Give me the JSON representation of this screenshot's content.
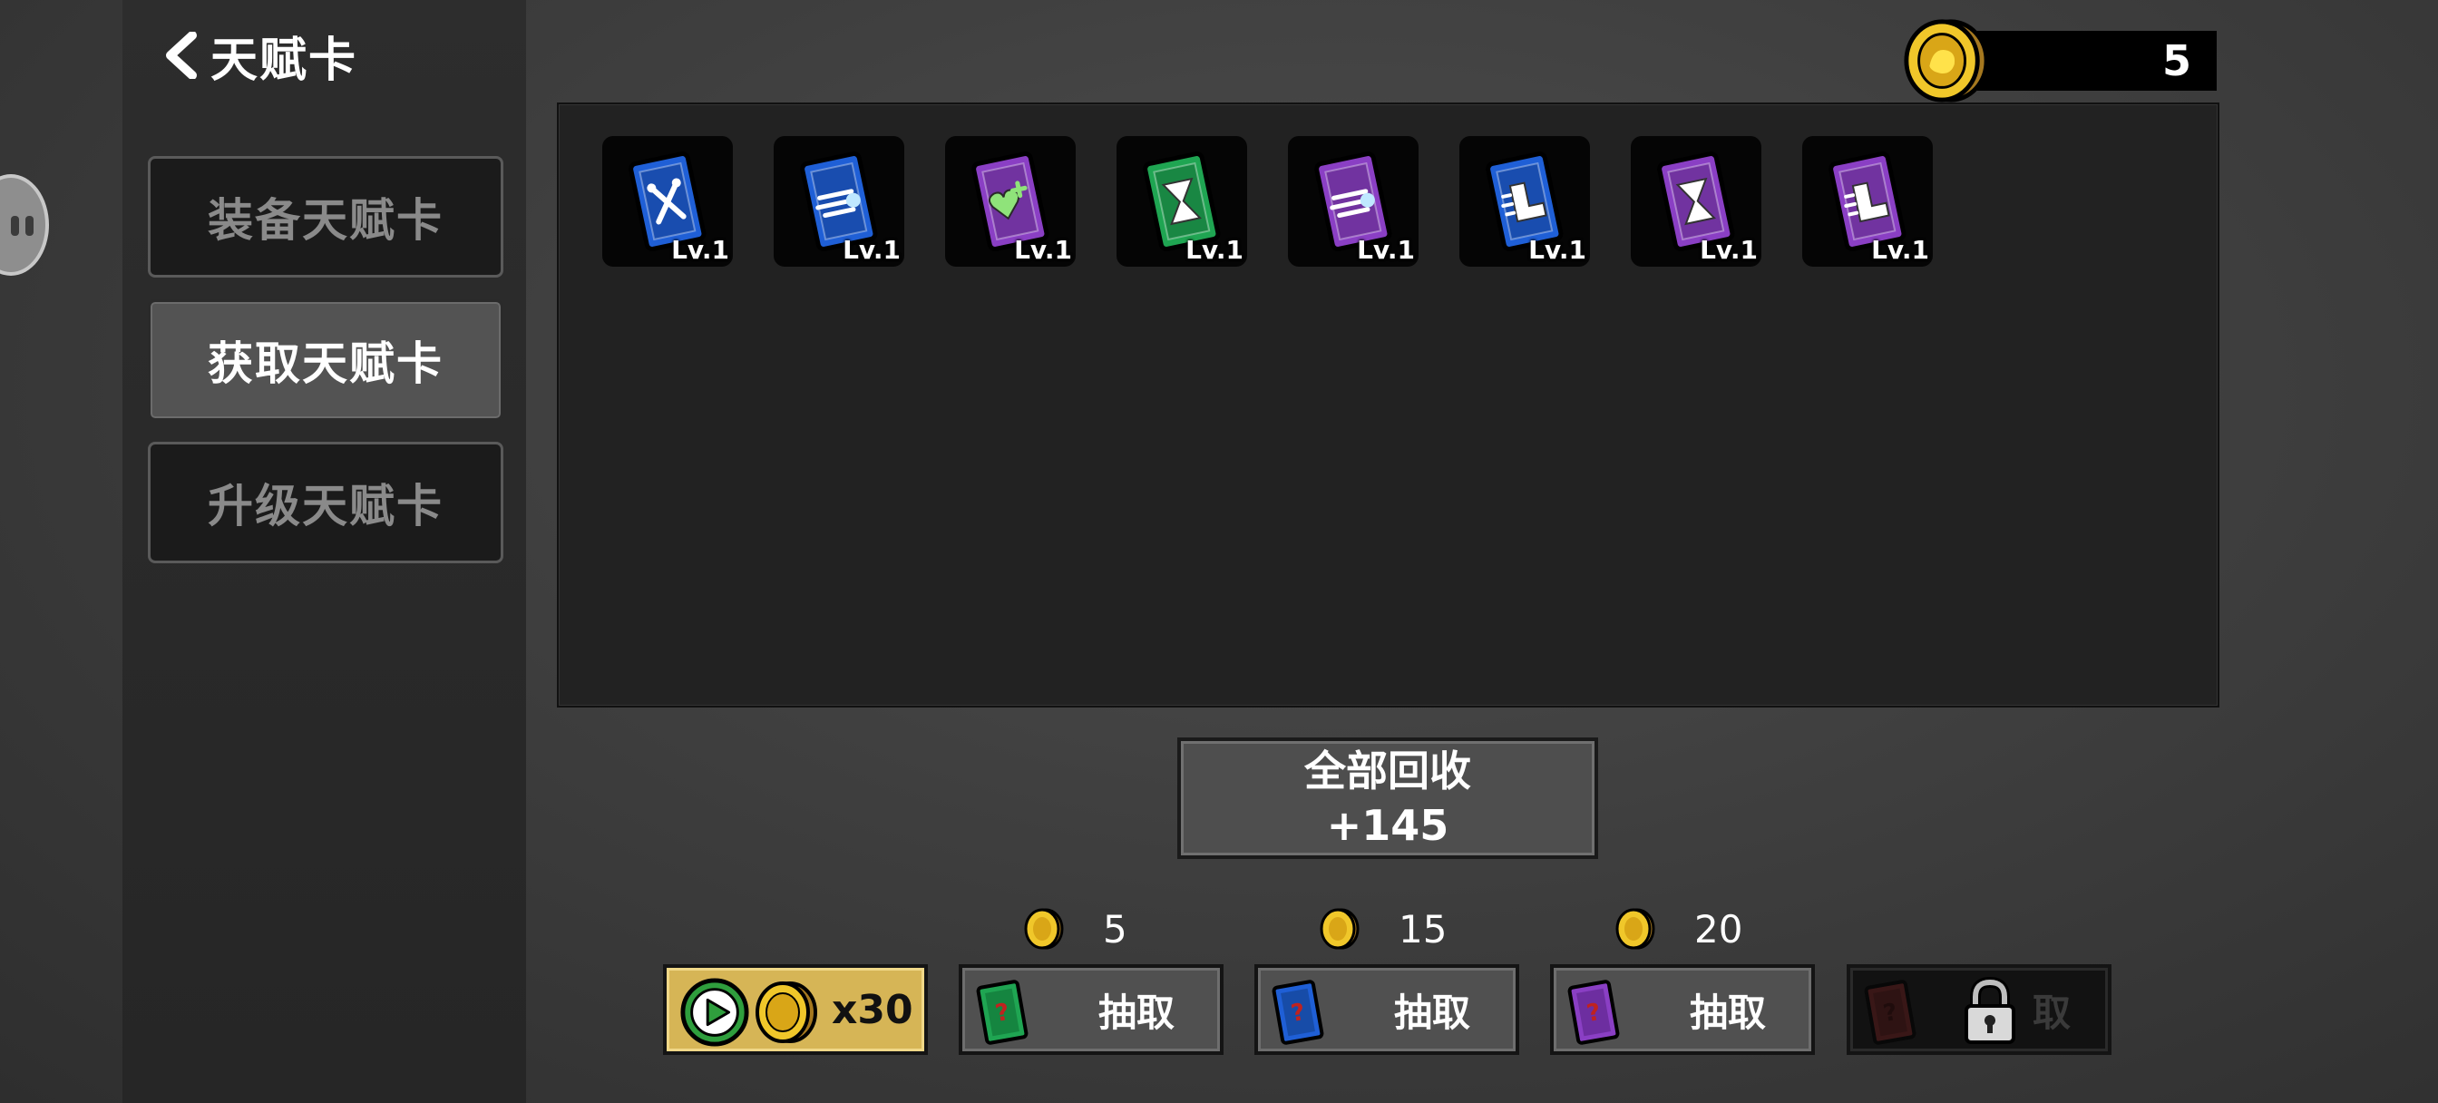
{
  "header": {
    "title": "天赋卡",
    "coin_count": "5"
  },
  "sidebar": {
    "items": [
      {
        "label": "装备天赋卡",
        "active": false
      },
      {
        "label": "获取天赋卡",
        "active": true
      },
      {
        "label": "升级天赋卡",
        "active": false
      }
    ]
  },
  "cards": [
    {
      "color": "#1f5fd6",
      "icon": "crossed-tools-icon",
      "level": "Lv.1"
    },
    {
      "color": "#1f5fd6",
      "icon": "speed-lines-icon",
      "level": "Lv.1"
    },
    {
      "color": "#8a3fc4",
      "icon": "heart-plus-icon",
      "level": "Lv.1"
    },
    {
      "color": "#1fa552",
      "icon": "hourglass-icon",
      "level": "Lv.1"
    },
    {
      "color": "#8a3fc4",
      "icon": "speed-lines-icon",
      "level": "Lv.1"
    },
    {
      "color": "#1f5fd6",
      "icon": "boot-icon",
      "level": "Lv.1"
    },
    {
      "color": "#8a3fc4",
      "icon": "hourglass-icon",
      "level": "Lv.1"
    },
    {
      "color": "#8a3fc4",
      "icon": "boot-icon",
      "level": "Lv.1"
    }
  ],
  "recycle": {
    "label": "全部回收",
    "value": "+145"
  },
  "ad_button": {
    "label": "x30"
  },
  "draw_buttons": [
    {
      "color": "#1fa552",
      "price": "5",
      "label": "抽取",
      "locked": false
    },
    {
      "color": "#1f5fd6",
      "price": "15",
      "label": "抽取",
      "locked": false
    },
    {
      "color": "#8a3fc4",
      "price": "20",
      "label": "抽取",
      "locked": false
    },
    {
      "color": "#5a1c1c",
      "label": "取",
      "locked": true
    }
  ]
}
